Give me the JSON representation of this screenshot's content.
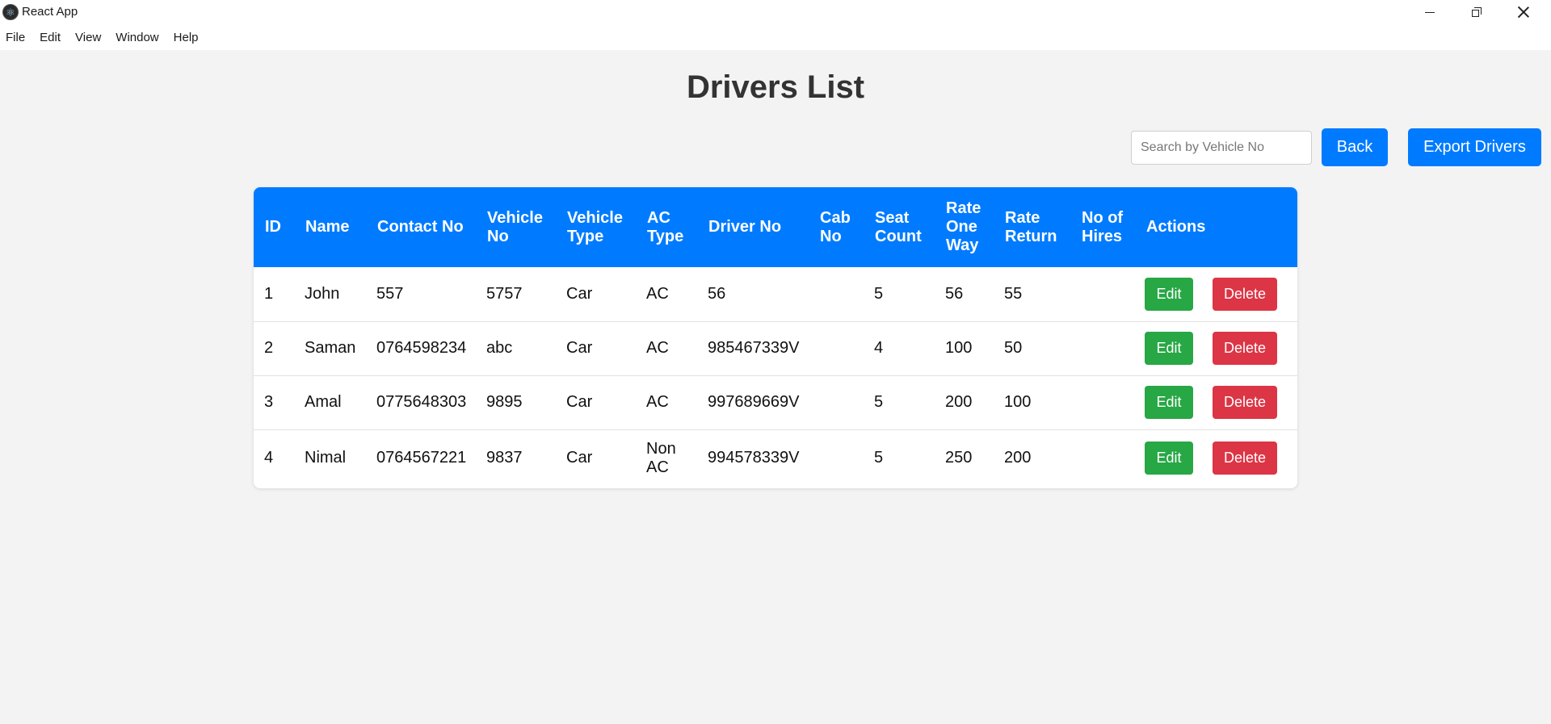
{
  "window": {
    "title": "React App",
    "icon": "react-atom-icon"
  },
  "menu": {
    "items": [
      "File",
      "Edit",
      "View",
      "Window",
      "Help"
    ]
  },
  "page": {
    "title": "Drivers List"
  },
  "toolbar": {
    "search_placeholder": "Search by Vehicle No",
    "search_value": "",
    "back_label": "Back",
    "export_label": "Export Drivers"
  },
  "table": {
    "headers": [
      "ID",
      "Name",
      "Contact No",
      "Vehicle No",
      "Vehicle Type",
      "AC Type",
      "Driver No",
      "Cab No",
      "Seat Count",
      "Rate One Way",
      "Rate Return",
      "No of Hires",
      "Actions"
    ],
    "rows": [
      {
        "id": "1",
        "name": "John",
        "contact": "557",
        "vehicle_no": "5757",
        "vehicle_type": "Car",
        "ac_type": "AC",
        "driver_no": "56",
        "cab_no": "",
        "seat_count": "5",
        "rate_one_way": "56",
        "rate_return": "55",
        "no_of_hires": ""
      },
      {
        "id": "2",
        "name": "Saman",
        "contact": "0764598234",
        "vehicle_no": "abc",
        "vehicle_type": "Car",
        "ac_type": "AC",
        "driver_no": "985467339V",
        "cab_no": "",
        "seat_count": "4",
        "rate_one_way": "100",
        "rate_return": "50",
        "no_of_hires": ""
      },
      {
        "id": "3",
        "name": "Amal",
        "contact": "0775648303",
        "vehicle_no": "9895",
        "vehicle_type": "Car",
        "ac_type": "AC",
        "driver_no": "997689669V",
        "cab_no": "",
        "seat_count": "5",
        "rate_one_way": "200",
        "rate_return": "100",
        "no_of_hires": ""
      },
      {
        "id": "4",
        "name": "Nimal",
        "contact": "0764567221",
        "vehicle_no": "9837",
        "vehicle_type": "Car",
        "ac_type": "Non AC",
        "driver_no": "994578339V",
        "cab_no": "",
        "seat_count": "5",
        "rate_one_way": "250",
        "rate_return": "200",
        "no_of_hires": ""
      }
    ],
    "edit_label": "Edit",
    "delete_label": "Delete"
  },
  "colors": {
    "primary": "#007bff",
    "success": "#28a745",
    "danger": "#dc3545",
    "background": "#f3f3f3"
  }
}
